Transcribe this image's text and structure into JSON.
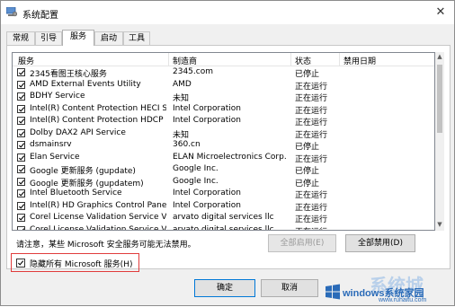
{
  "window": {
    "title": "系统配置",
    "close_glyph": "✕"
  },
  "tabs": [
    "常规",
    "引导",
    "服务",
    "启动",
    "工具"
  ],
  "active_tab": "服务",
  "columns": {
    "service": "服务",
    "manufacturer": "制造商",
    "status": "状态",
    "disabled_date": "禁用日期"
  },
  "services": [
    {
      "name": "2345看图王核心服务",
      "manufacturer": "2345.com",
      "status": "已停止",
      "checked": true
    },
    {
      "name": "AMD External Events Utility",
      "manufacturer": "AMD",
      "status": "正在运行",
      "checked": true
    },
    {
      "name": "BDHY Service",
      "manufacturer": "未知",
      "status": "正在运行",
      "checked": true
    },
    {
      "name": "Intel(R) Content Protection HECI Ser...",
      "manufacturer": "Intel Corporation",
      "status": "正在运行",
      "checked": true
    },
    {
      "name": "Intel(R) Content Protection HDCP Se...",
      "manufacturer": "Intel Corporation",
      "status": "正在运行",
      "checked": true
    },
    {
      "name": "Dolby DAX2 API Service",
      "manufacturer": "未知",
      "status": "正在运行",
      "checked": true
    },
    {
      "name": "dsmainsrv",
      "manufacturer": "360.cn",
      "status": "已停止",
      "checked": true
    },
    {
      "name": "Elan Service",
      "manufacturer": "ELAN Microelectronics Corp.",
      "status": "正在运行",
      "checked": true
    },
    {
      "name": "Google 更新服务 (gupdate)",
      "manufacturer": "Google Inc.",
      "status": "已停止",
      "checked": true
    },
    {
      "name": "Google 更新服务 (gupdatem)",
      "manufacturer": "Google Inc.",
      "status": "已停止",
      "checked": true
    },
    {
      "name": "Intel Bluetooth Service",
      "manufacturer": "Intel Corporation",
      "status": "正在运行",
      "checked": true
    },
    {
      "name": "Intel(R) HD Graphics Control Panel S...",
      "manufacturer": "Intel Corporation",
      "status": "正在运行",
      "checked": true
    },
    {
      "name": "Corel License Validation Service V2, ...",
      "manufacturer": "arvato digital services llc",
      "status": "正在运行",
      "checked": true
    },
    {
      "name": "Corel License Validation Service V2, ...",
      "manufacturer": "arvato digital services llc",
      "status": "正在运行",
      "checked": true
    }
  ],
  "note": "请注意，某些 Microsoft 安全服务可能无法禁用。",
  "buttons": {
    "enable_all": "全部启用(E)",
    "disable_all": "全部禁用(D)",
    "ok": "确定",
    "cancel": "取消"
  },
  "hide_ms": {
    "label": "隐藏所有 Microsoft 服务(H)",
    "checked": true
  },
  "watermark": {
    "brand": "windows系统家园",
    "url": "www.ruhaitu.com",
    "cn": "系统城"
  }
}
